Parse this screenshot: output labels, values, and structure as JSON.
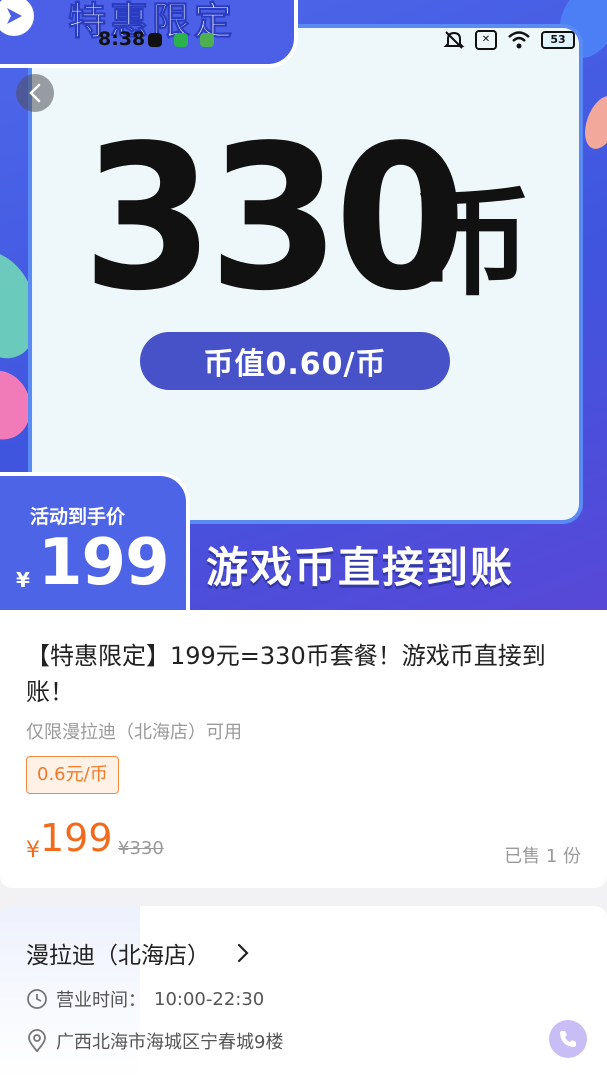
{
  "status_bar": {
    "time": "8:38",
    "battery": "53"
  },
  "banner": {
    "tag": "特惠限定",
    "amount": "330",
    "unit": "币",
    "rate_pill": "币值0.60/币",
    "promo_label": "活动到手价",
    "currency": "¥",
    "promo_price": "199",
    "slogan": "游戏币直接到账"
  },
  "product": {
    "title": "【特惠限定】199元=330币套餐！游戏币直接到账！",
    "restriction": "仅限漫拉迪（北海店）可用",
    "badge": "0.6元/币",
    "currency": "¥",
    "price": "199",
    "original_price": "¥330",
    "sold": "已售 1 份"
  },
  "store": {
    "name": "漫拉迪（北海店）",
    "hours_label": "营业时间：",
    "hours": "10:00-22:30",
    "address": "广西北海市海城区宁春城9楼"
  },
  "colors": {
    "accent_orange": "#f26b1d",
    "banner_blue": "#4b60e6"
  },
  "icons": [
    "back-icon",
    "chevron-right-icon",
    "clock-icon",
    "location-icon",
    "phone-icon",
    "play-arrow-icon"
  ]
}
